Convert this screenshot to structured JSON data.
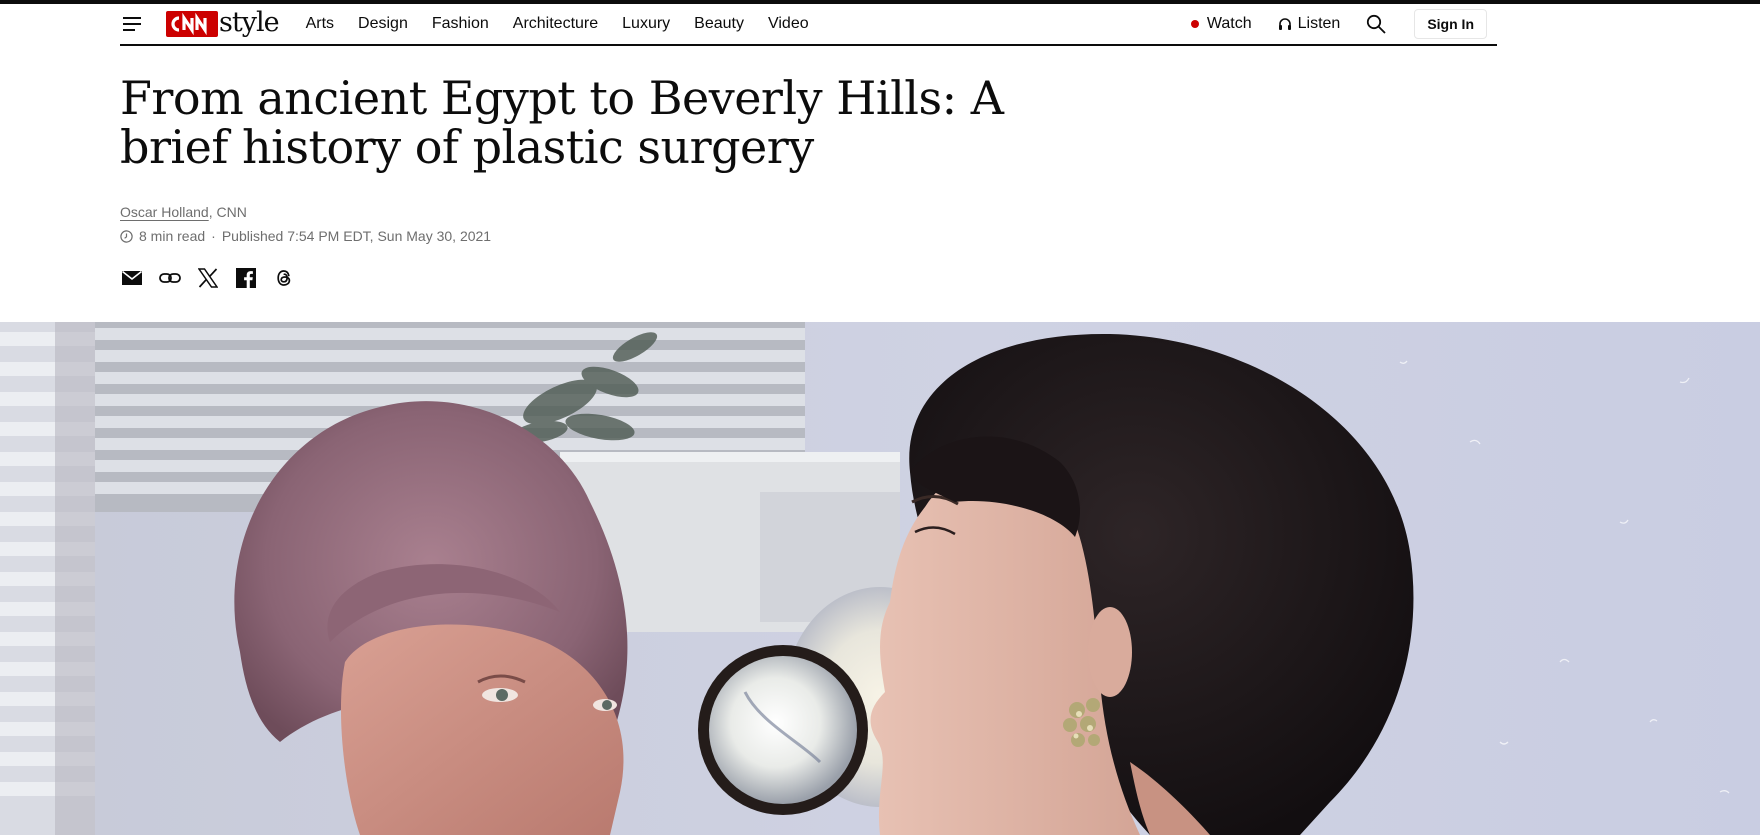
{
  "header": {
    "menu_icon": "hamburger-menu-icon",
    "logo": {
      "brand": "CNN",
      "section": "style"
    },
    "nav": [
      "Arts",
      "Design",
      "Fashion",
      "Architecture",
      "Luxury",
      "Beauty",
      "Video"
    ],
    "watch_label": "Watch",
    "listen_label": "Listen",
    "search_icon": "search-icon",
    "signin_label": "Sign In",
    "colors": {
      "brand_red": "#cc0000",
      "text": "#0c0c0c"
    }
  },
  "article": {
    "headline": "From ancient Egypt to Beverly Hills: A brief history of plastic surgery",
    "author": "Oscar Holland",
    "source": ", CNN",
    "read_time": "8 min read",
    "separator": "·",
    "published": "Published 7:54 PM EDT, Sun May 30, 2021"
  },
  "share": {
    "icons": [
      "email-icon",
      "link-icon",
      "x-icon",
      "facebook-icon",
      "threads-icon"
    ]
  },
  "hero": {
    "description_icon": "hero-photo"
  }
}
